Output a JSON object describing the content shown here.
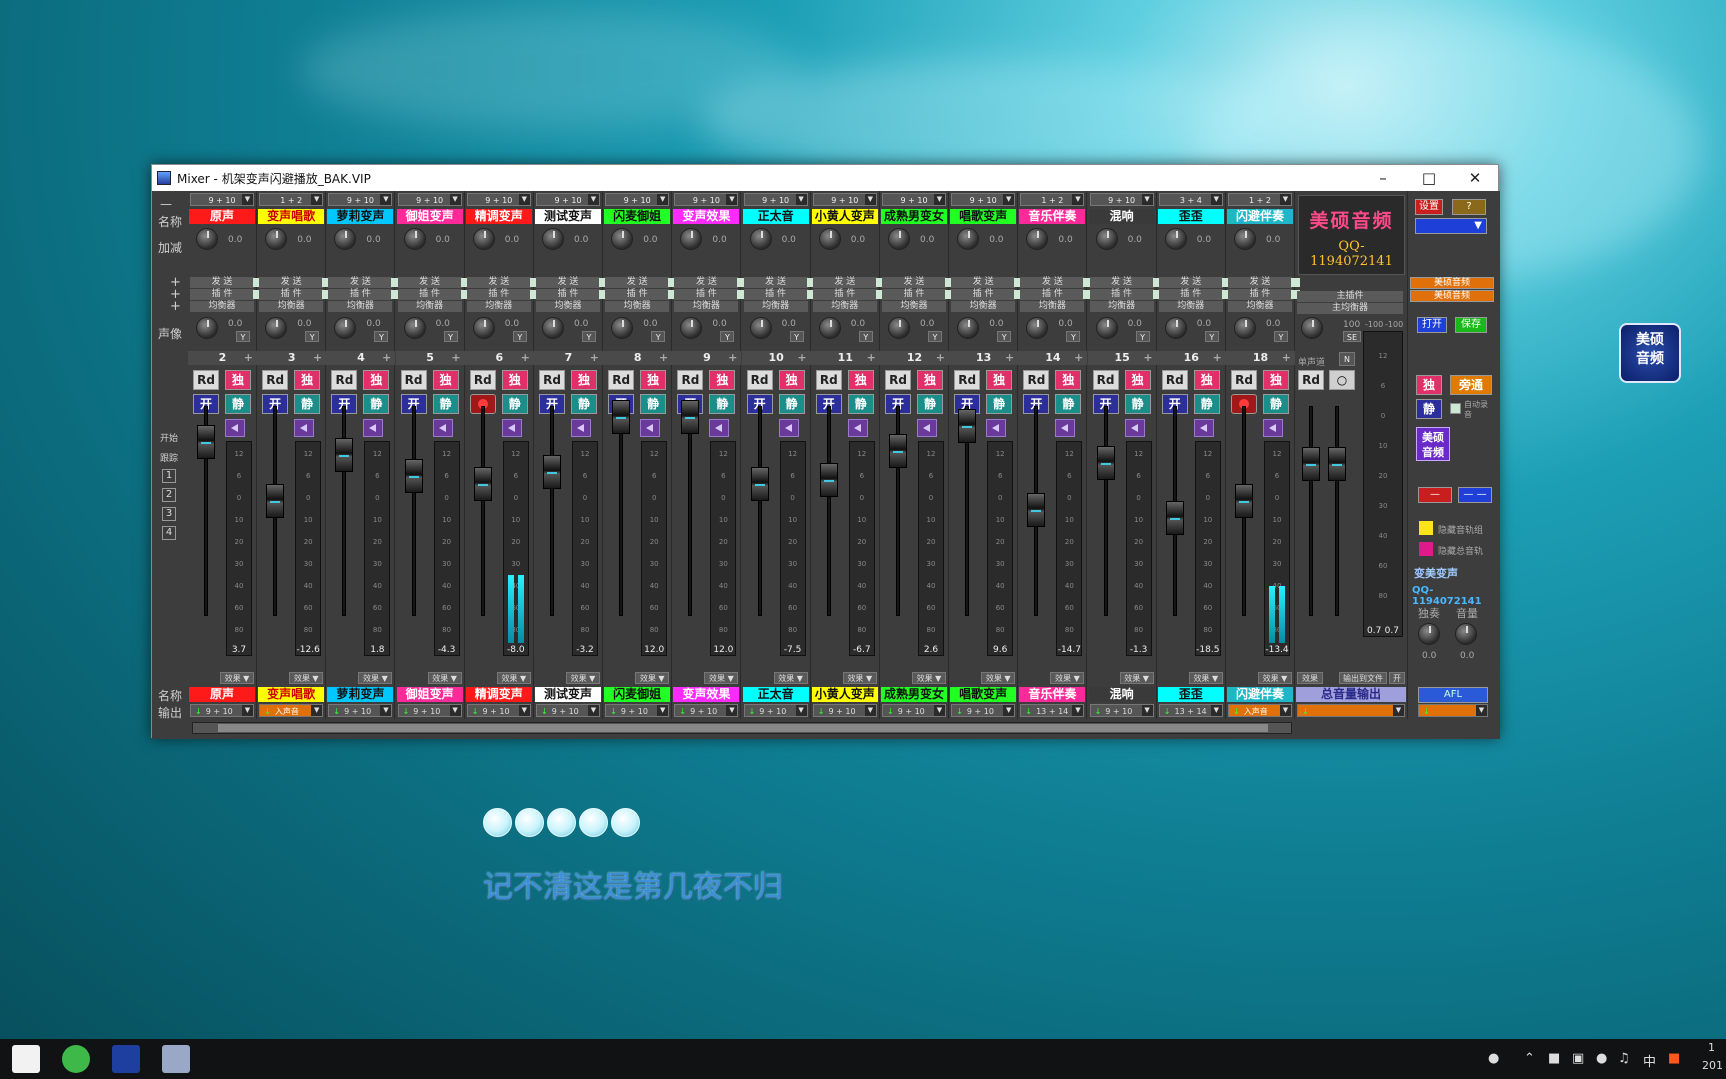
{
  "window": {
    "title": "Mixer - 机架变声闪避播放_BAK.VIP"
  },
  "labels": {
    "name": "名称",
    "gain": "加减",
    "pan": "声像",
    "start": "开始",
    "follow": "跟踪",
    "output": "输出",
    "send": "发 送",
    "plugin": "插 件",
    "eq": "均衡器",
    "fx": "效果",
    "plus": "+",
    "dash": "—"
  },
  "side_numbers": [
    "1",
    "2",
    "3",
    "4"
  ],
  "strips": [
    {
      "num": "2",
      "name": "原声",
      "name_bg": "#ff1a1a",
      "name_fg": "#ffffff",
      "input": "9 + 10",
      "output": "9 + 10",
      "val": "3.7",
      "gain": "0.0",
      "pan": "0.0",
      "fader": 0.14,
      "lvl": 0.0,
      "rec": false
    },
    {
      "num": "3",
      "name": "变声唱歌",
      "name_bg": "#ffff00",
      "name_fg": "#cc0000",
      "input": "1 + 2",
      "output": "入声音",
      "val": "-12.6",
      "gain": "0.0",
      "pan": "0.0",
      "fader": 0.42,
      "lvl": 0.0,
      "rec": false
    },
    {
      "num": "4",
      "name": "萝莉变声",
      "name_bg": "#00c8ff",
      "name_fg": "#111111",
      "input": "9 + 10",
      "output": "9 + 10",
      "val": "1.8",
      "gain": "0.0",
      "pan": "0.0",
      "fader": 0.2,
      "lvl": 0.0,
      "rec": false
    },
    {
      "num": "5",
      "name": "御姐变声",
      "name_bg": "#ff2a9a",
      "name_fg": "#ffffff",
      "input": "9 + 10",
      "output": "9 + 10",
      "val": "-4.3",
      "gain": "0.0",
      "pan": "0.0",
      "fader": 0.3,
      "lvl": 0.0,
      "rec": false
    },
    {
      "num": "6",
      "name": "精调变声",
      "name_bg": "#ff1a1a",
      "name_fg": "#ffffff",
      "input": "9 + 10",
      "output": "9 + 10",
      "val": "-8.0",
      "gain": "0.0",
      "pan": "0.0",
      "fader": 0.34,
      "lvl": 0.36,
      "rec": true
    },
    {
      "num": "7",
      "name": "测试变声",
      "name_bg": "#ffffff",
      "name_fg": "#111111",
      "input": "9 + 10",
      "output": "9 + 10",
      "val": "-3.2",
      "gain": "0.0",
      "pan": "0.0",
      "fader": 0.28,
      "lvl": 0.0,
      "rec": false
    },
    {
      "num": "8",
      "name": "闪麦御姐",
      "name_bg": "#22ff22",
      "name_fg": "#111111",
      "input": "9 + 10",
      "output": "9 + 10",
      "val": "12.0",
      "gain": "0.0",
      "pan": "0.0",
      "fader": 0.02,
      "lvl": 0.0,
      "rec": false
    },
    {
      "num": "9",
      "name": "变声效果",
      "name_bg": "#ff2aff",
      "name_fg": "#ffffff",
      "input": "9 + 10",
      "output": "9 + 10",
      "val": "12.0",
      "gain": "0.0",
      "pan": "0.0",
      "fader": 0.02,
      "lvl": 0.0,
      "rec": false
    },
    {
      "num": "10",
      "name": "正太音",
      "name_bg": "#00ffff",
      "name_fg": "#111111",
      "input": "9 + 10",
      "output": "9 + 10",
      "val": "-7.5",
      "gain": "0.0",
      "pan": "0.0",
      "fader": 0.34,
      "lvl": 0.0,
      "rec": false
    },
    {
      "num": "11",
      "name": "小黄人变声",
      "name_bg": "#ffff00",
      "name_fg": "#111111",
      "input": "9 + 10",
      "output": "9 + 10",
      "val": "-6.7",
      "gain": "0.0",
      "pan": "0.0",
      "fader": 0.32,
      "lvl": 0.0,
      "rec": false
    },
    {
      "num": "12",
      "name": "成熟男变女",
      "name_bg": "#22ff22",
      "name_fg": "#111111",
      "input": "9 + 10",
      "output": "9 + 10",
      "val": "2.6",
      "gain": "0.0",
      "pan": "0.0",
      "fader": 0.18,
      "lvl": 0.0,
      "rec": false
    },
    {
      "num": "13",
      "name": "唱歌变声",
      "name_bg": "#22ff22",
      "name_fg": "#111111",
      "input": "9 + 10",
      "output": "9 + 10",
      "val": "9.6",
      "gain": "0.0",
      "pan": "0.0",
      "fader": 0.06,
      "lvl": 0.0,
      "rec": false
    },
    {
      "num": "14",
      "name": "音乐伴奏",
      "name_bg": "#ff2a9a",
      "name_fg": "#ffffff",
      "input": "1 + 2",
      "output": "13 + 14",
      "val": "-14.7",
      "gain": "0.0",
      "pan": "0.0",
      "fader": 0.46,
      "lvl": 0.0,
      "rec": false
    },
    {
      "num": "15",
      "name": "混响",
      "name_bg": "#3a3a3a",
      "name_fg": "#ffffff",
      "input": "9 + 10",
      "output": "9 + 10",
      "val": "-1.3",
      "gain": "0.0",
      "pan": "0.0",
      "fader": 0.24,
      "lvl": 0.0,
      "rec": false
    },
    {
      "num": "16",
      "name": "歪歪",
      "name_bg": "#00ffff",
      "name_fg": "#111111",
      "input": "3 + 4",
      "output": "13 + 14",
      "val": "-18.5",
      "gain": "0.0",
      "pan": "0.0",
      "fader": 0.5,
      "lvl": 0.0,
      "rec": false
    },
    {
      "num": "18",
      "name": "闪避伴奏",
      "name_bg": "#1fb7c7",
      "name_fg": "#ffffff",
      "input": "1 + 2",
      "output": "入声音",
      "val": "-13.4",
      "gain": "0.0",
      "pan": "0.0",
      "fader": 0.42,
      "lvl": 0.3,
      "rec": true
    }
  ],
  "master": {
    "name": "总音量输出",
    "pan_val": "100",
    "se": "SE",
    "mono": "单声道",
    "n": "N",
    "fx": "效果",
    "file": "输出到文件",
    "on": "开",
    "left": "0.7",
    "right": "0.7",
    "db1": "-100",
    "db2": "-100",
    "main_plugin": "主插件",
    "main_eq": "主均衡器",
    "main_plugin_side": "美硕音频",
    "main_eq_side": "美硕音频"
  },
  "brand": {
    "line1": "美硕音频",
    "line2": "QQ-1194072141",
    "sub1": "变美变声",
    "sub2": "QQ-1194072141"
  },
  "right_panel": {
    "setup": "设置",
    "help": "?",
    "open": "打开",
    "save": "保存",
    "solo": "独",
    "bypass": "旁通",
    "mute": "静",
    "auto_rec": "自动录音",
    "meishuo": "美硕音频",
    "minus": "—",
    "dash2": "— —",
    "hide_tracks": "隐藏音轨组",
    "hide_all": "隐藏总音轨",
    "solo_lbl": "独奏",
    "vol_lbl": "音量",
    "v1": "0.0",
    "v2": "0.0",
    "afl": "AFL"
  },
  "buttons": {
    "rd": "Rd",
    "solo": "独",
    "on": "开",
    "mute": "静",
    "y": "Y"
  },
  "meter_scale": [
    "12",
    "6",
    "0",
    "10",
    "20",
    "30",
    "40",
    "60",
    "80"
  ],
  "master_scale": [
    "12",
    "6",
    "0",
    "10",
    "20",
    "30",
    "40",
    "60",
    "80"
  ],
  "lyrics": {
    "text": "记不清这是第几夜不归"
  },
  "desktop_icon": {
    "l1": "美硕",
    "l2": "音频"
  },
  "taskbar": {
    "ime": "中",
    "time": "1",
    "date": "201"
  }
}
